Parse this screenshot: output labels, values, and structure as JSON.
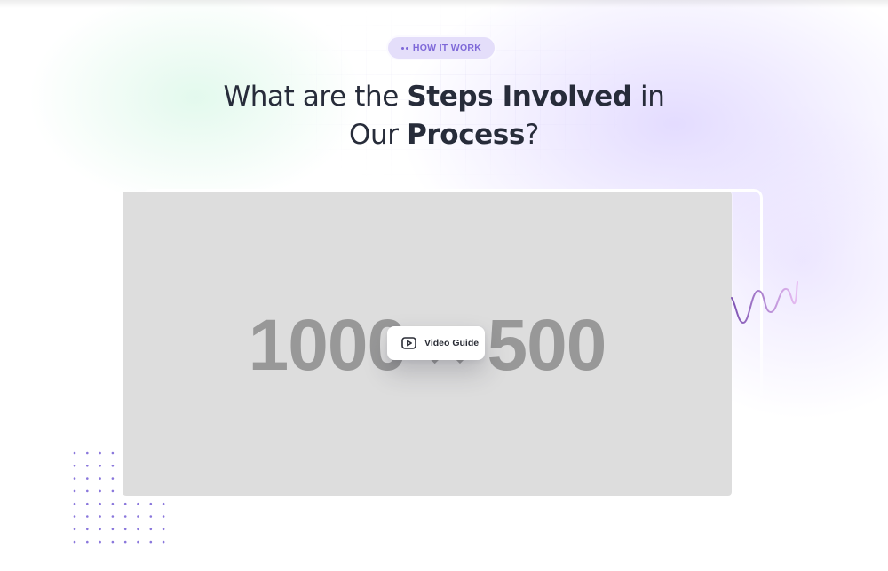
{
  "section": {
    "badge": {
      "label": "HOW IT WORK",
      "icon": "dots-arrow-icon"
    },
    "heading": {
      "line1_pre": "What are the ",
      "line1_bold": "Steps Involved",
      "line1_post": " in",
      "line2_pre": "Our ",
      "line2_bold": "Process",
      "line2_post": "?"
    }
  },
  "media": {
    "placeholder_text": "1000 × 500",
    "video_button": {
      "label": "Video Guide",
      "icon": "play-icon"
    }
  },
  "colors": {
    "accent": "#7e68d8",
    "badge_bg": "#e4defa",
    "heading": "#272c3a",
    "placeholder_bg": "#dddddd",
    "placeholder_text": "#989898",
    "dot_grid": "#8a77dc",
    "squiggle_start": "#7d52b2",
    "squiggle_end": "#e7bdf2"
  }
}
